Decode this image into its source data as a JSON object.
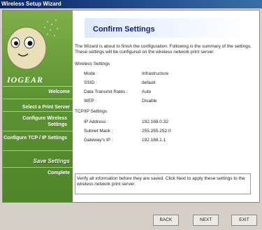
{
  "window": {
    "title": "Wireless Setup Wizard"
  },
  "sidebar": {
    "logo": "IOGEAR",
    "steps": [
      "Welcome",
      "Select a Print Server",
      "Configure Wireless Settings",
      "Configure TCP / IP Settings",
      "Save Settings",
      "Complete"
    ],
    "active_step": "Save Settings"
  },
  "main": {
    "title": "Confirm Settings",
    "intro": "The Wizard is about to finish the configuration. Following is the summary of the settings. These settings will be configured on the wireless network print server.",
    "wireless": {
      "heading": "Wireless Settings",
      "rows": [
        {
          "label": "Mode :",
          "value": "Infrastructure"
        },
        {
          "label": "SSID :",
          "value": "default"
        },
        {
          "label": "Data Transmit Rates :",
          "value": "Auto"
        },
        {
          "label": "WEP :",
          "value": "Disable"
        }
      ]
    },
    "tcpip": {
      "heading": "TCP/IP Settings",
      "rows": [
        {
          "label": "IP Address :",
          "value": "192.168.0.32"
        },
        {
          "label": "Subnet Mask :",
          "value": "255.255.252.0"
        },
        {
          "label": "Gateway's IP :",
          "value": "192.168.1.1"
        }
      ]
    },
    "note": "Verify all information before they are saved. Click Next to apply these settings to the wireless network print server."
  },
  "buttons": {
    "back": "BACK",
    "next": "NEXT",
    "exit": "EXIT"
  }
}
